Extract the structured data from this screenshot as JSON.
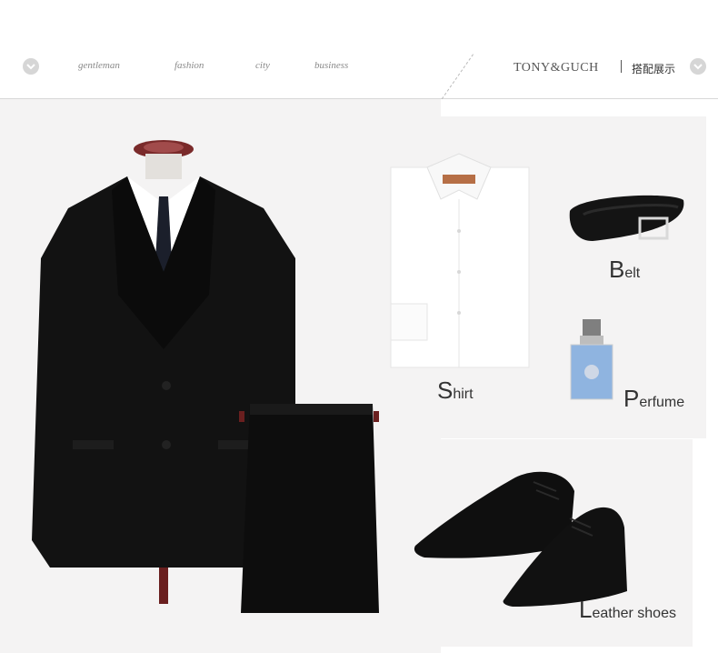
{
  "nav": {
    "items": [
      "gentleman",
      "fashion",
      "city",
      "business"
    ]
  },
  "brand": {
    "name": "TONY&GUCH",
    "subtitle": "搭配展示"
  },
  "products": {
    "belt": {
      "cap": "B",
      "rest": "elt"
    },
    "shirt": {
      "cap": "S",
      "rest": "hirt"
    },
    "perfume": {
      "cap": "P",
      "rest": "erfume"
    },
    "shoes": {
      "cap": "L",
      "rest": "eather shoes"
    }
  },
  "icons": {
    "left_chevron": "chevron-down-icon",
    "right_chevron": "chevron-down-icon"
  },
  "colors": {
    "panel": "#f4f3f3",
    "text": "#333333"
  }
}
